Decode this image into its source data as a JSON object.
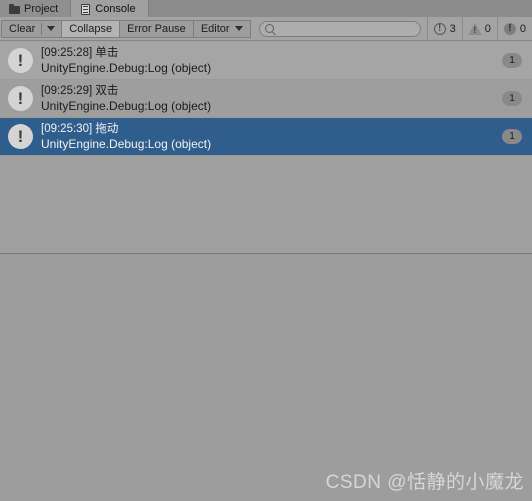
{
  "window": {
    "tabs": [
      {
        "label": "Project",
        "icon": "folder-icon",
        "active": false
      },
      {
        "label": "Console",
        "icon": "console-icon",
        "active": true
      }
    ]
  },
  "toolbar": {
    "clear_label": "Clear",
    "collapse_label": "Collapse",
    "error_pause_label": "Error Pause",
    "editor_label": "Editor",
    "search": {
      "value": "",
      "placeholder": ""
    },
    "counters": [
      {
        "name": "log-count",
        "icon": "log-icon",
        "value": "3"
      },
      {
        "name": "warning-count",
        "icon": "warning-icon",
        "value": "0"
      },
      {
        "name": "error-count",
        "icon": "error-icon",
        "value": "0"
      }
    ]
  },
  "console": {
    "entries": [
      {
        "message": "[09:25:28] 单击",
        "stack": "UnityEngine.Debug:Log (object)",
        "count": "1",
        "selected": false,
        "icon": "log-bubble-icon"
      },
      {
        "message": "[09:25:29] 双击",
        "stack": "UnityEngine.Debug:Log (object)",
        "count": "1",
        "selected": false,
        "icon": "log-bubble-icon"
      },
      {
        "message": "[09:25:30] 拖动",
        "stack": "UnityEngine.Debug:Log (object)",
        "count": "1",
        "selected": true,
        "icon": "log-bubble-icon"
      }
    ],
    "detail_text": ""
  },
  "watermark": "CSDN @恬静的小魔龙",
  "colors": {
    "selection_blue": "#2f5d8c",
    "panel_gray": "#a0a0a0",
    "toolbar_gray": "#a4a4a4",
    "tabbar_gray": "#8c8c8c",
    "watermark_gray": "#d6d6d6"
  }
}
